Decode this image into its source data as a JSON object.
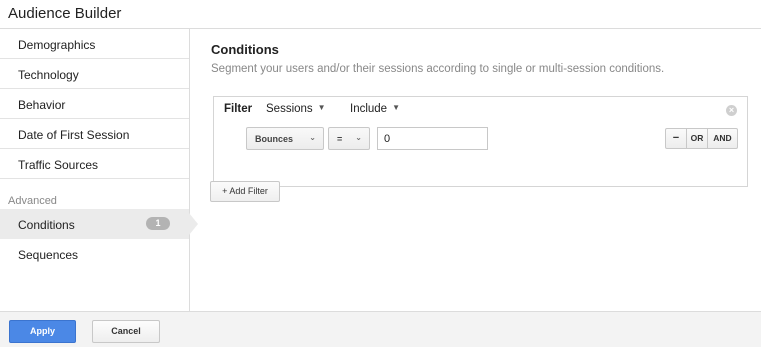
{
  "window": {
    "title": "Audience Builder"
  },
  "sidebar": {
    "items": [
      {
        "label": "Demographics"
      },
      {
        "label": "Technology"
      },
      {
        "label": "Behavior"
      },
      {
        "label": "Date of First Session"
      },
      {
        "label": "Traffic Sources"
      }
    ],
    "advanced_label": "Advanced",
    "advanced_items": [
      {
        "label": "Conditions",
        "badge": "1",
        "active": true
      },
      {
        "label": "Sequences"
      }
    ]
  },
  "main": {
    "title": "Conditions",
    "subtitle": "Segment your users and/or their sessions according to single or multi-session conditions.",
    "filter": {
      "label": "Filter",
      "scope": "Sessions",
      "mode": "Include",
      "metric": "Bounces",
      "operator": "=",
      "value": "0",
      "ops": {
        "minus": "−",
        "or": "OR",
        "and": "AND"
      }
    },
    "add_filter_label": "+ Add Filter"
  },
  "footer": {
    "apply_label": "Apply",
    "cancel_label": "Cancel"
  },
  "colors": {
    "accent": "#4b88e6",
    "active_bg": "#ebebeb",
    "badge": "#b3b3b3"
  },
  "icons": {
    "caret": "caret-down-icon",
    "remove": "remove-circle-icon"
  }
}
